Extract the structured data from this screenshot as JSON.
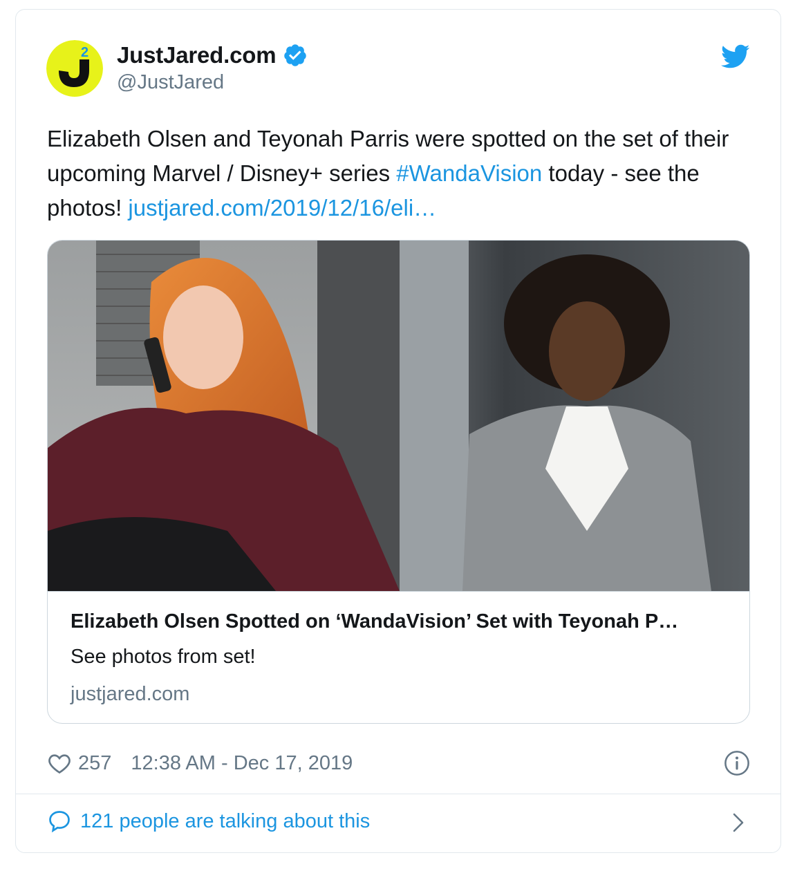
{
  "account": {
    "name": "JustJared.com",
    "handle": "@JustJared",
    "avatar_text": "J",
    "avatar_badge": "2"
  },
  "tweet": {
    "text_parts": [
      "Elizabeth Olsen and Teyonah Parris were spotted on the set of their upcoming Marvel / Disney+ series ",
      "#WandaVision",
      " today - see the photos! ",
      "justjared.com/2019/12/16/eli…"
    ]
  },
  "card": {
    "title": "Elizabeth Olsen Spotted on ‘WandaVision’ Set with Teyonah P…",
    "description": "See photos from set!",
    "domain": "justjared.com"
  },
  "meta": {
    "likes": "257",
    "timestamp": "12:38 AM - Dec 17, 2019"
  },
  "footer": {
    "talking": "121 people are talking about this"
  },
  "colors": {
    "link": "#1b95e0",
    "text": "#14171a",
    "muted": "#657786",
    "avatar_yellow": "#e7f21a"
  },
  "icons": {
    "verified": "verified-badge-icon",
    "bird": "twitter-bird-icon",
    "heart": "heart-icon",
    "info": "info-icon",
    "bubble": "speech-bubble-icon",
    "chevron": "chevron-right-icon"
  }
}
